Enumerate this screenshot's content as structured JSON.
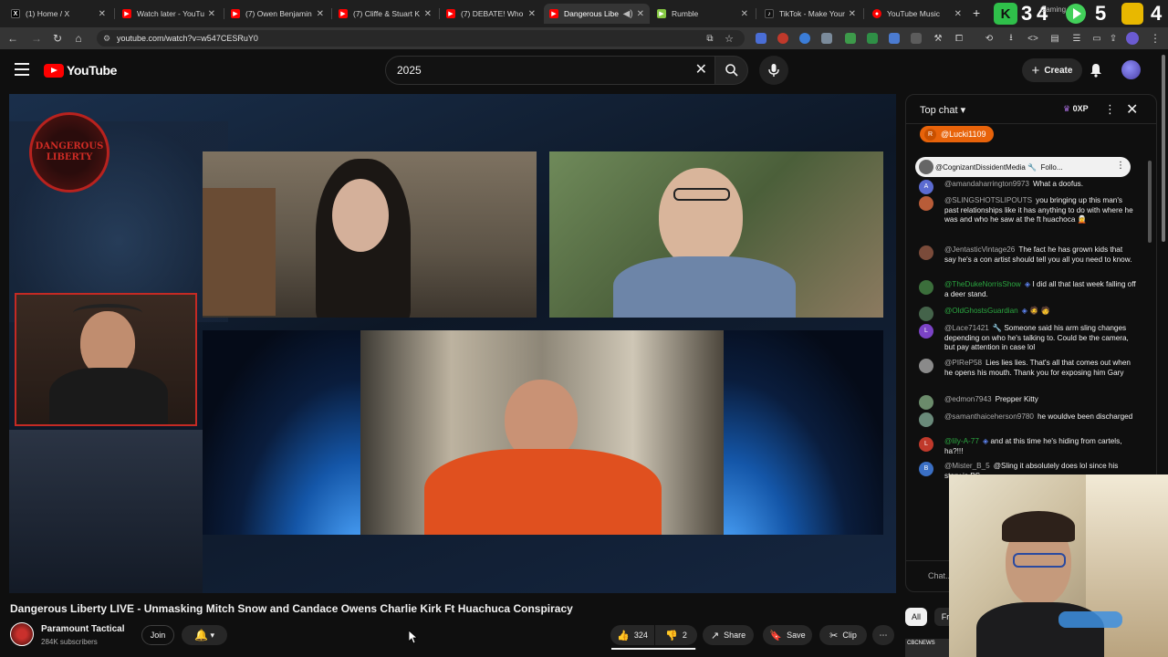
{
  "browser": {
    "tabs": [
      {
        "label": "(1) Home / X",
        "favicon": "x-logo-icon",
        "color": "#000000"
      },
      {
        "label": "Watch later - YouTu",
        "favicon": "youtube-icon",
        "color": "#ff0000"
      },
      {
        "label": "(7) Owen Benjamin",
        "favicon": "youtube-icon",
        "color": "#ff0000"
      },
      {
        "label": "(7) Cliffe & Stuart K",
        "favicon": "youtube-icon",
        "color": "#ff0000"
      },
      {
        "label": "(7) DEBATE! Who A",
        "favicon": "youtube-icon",
        "color": "#ff0000"
      },
      {
        "label": "Dangerous Libe",
        "favicon": "youtube-icon",
        "color": "#ff0000",
        "active": true
      },
      {
        "label": "Rumble",
        "favicon": "rumble-icon",
        "color": "#85c742"
      },
      {
        "label": "TikTok - Make Your",
        "favicon": "tiktok-icon",
        "color": "#111111"
      },
      {
        "label": "YouTube Music",
        "favicon": "youtube-music-icon",
        "color": "#ff0000"
      }
    ],
    "url": "youtube.com/watch?v=w547CESRuY0",
    "overlay_text": "34 5 4",
    "overlay_digits": [
      "3",
      "4",
      "5",
      "4"
    ],
    "overlay_label": "Gaming"
  },
  "header": {
    "logo_text": "YouTube",
    "search_value": "2025",
    "create_label": "Create",
    "accent": "#ff0000"
  },
  "video": {
    "title": "Dangerous Liberty LIVE - Unmasking Mitch Snow and Candace Owens Charlie Kirk Ft Huachuca Conspiracy",
    "logo_text": "DANGEROUS LIBERTY",
    "channel": {
      "name": "Paramount Tactical",
      "subscribers": "284K subscribers",
      "join_label": "Join"
    },
    "actions": {
      "likes": "324",
      "dislikes": "2",
      "like_fraction": 0.994,
      "share_label": "Share",
      "save_label": "Save",
      "clip_label": "Clip"
    }
  },
  "chat": {
    "header_label": "Top chat",
    "xp_label": "0XP",
    "pinned": {
      "initial": "R",
      "handle": "@Lucki1109"
    },
    "ticker": {
      "handle": "@CognizantDissidentMedia",
      "action": "Follo..."
    },
    "messages": [
      {
        "initial": "A",
        "color": "#5b6bd1",
        "author": "@amandaharrington9973",
        "text": "What a doofus.",
        "style": "normal"
      },
      {
        "initial": "",
        "color": "#b85c38",
        "author": "@SLINGSHOTSLIPOUTS",
        "text": "you bringing up this man's past relationships like it has anything to do with where he was and who he saw at the ft huachoca",
        "style": "normal"
      },
      {
        "initial": "",
        "color": "#7a4b3a",
        "author": "@JentasticVintage26",
        "text": "The fact he has grown kids that say he's a con artist should tell you all you need to know.",
        "style": "normal"
      },
      {
        "initial": "",
        "color": "#3b6e3b",
        "author": "@TheDukeNorrisShow",
        "text": "I did all that last week falling off a deer stand.",
        "style": "green"
      },
      {
        "initial": "",
        "color": "#44634a",
        "author": "@OldGhostsGuardian",
        "text": "",
        "style": "green"
      },
      {
        "initial": "L",
        "color": "#7b43c5",
        "author": "@Lace71421",
        "text": "Someone said his arm sling changes depending on who he's talking to. Could be the camera, but pay attention in case lol",
        "style": "normal"
      },
      {
        "initial": "",
        "color": "#8a8a8a",
        "author": "@PIReP58",
        "text": "Lies lies lies. That's all that comes out when he opens his mouth. Thank you for exposing him Gary",
        "style": "normal"
      },
      {
        "initial": "",
        "color": "#6b8b6b",
        "author": "@edmon7943",
        "text": "Prepper Kitty",
        "style": "normal"
      },
      {
        "initial": "",
        "color": "#6a8a7a",
        "author": "@samanthaiceherson9780",
        "text": "he wouldve been discharged",
        "style": "normal"
      },
      {
        "initial": "L",
        "color": "#c0392b",
        "author": "@lily-A-77",
        "text": "and at this time he's hiding from cartels, ha?!!!",
        "style": "green"
      },
      {
        "initial": "B",
        "color": "#3a6fc4",
        "author": "@Mister_B_5",
        "text": "@Sling it absolutely does lol since his story is BS",
        "style": "normal"
      }
    ],
    "input_placeholder": "Chat..."
  },
  "below": {
    "chip_all": "All",
    "chip_second": "Fr",
    "thumb_text": "CBCNEWS"
  }
}
